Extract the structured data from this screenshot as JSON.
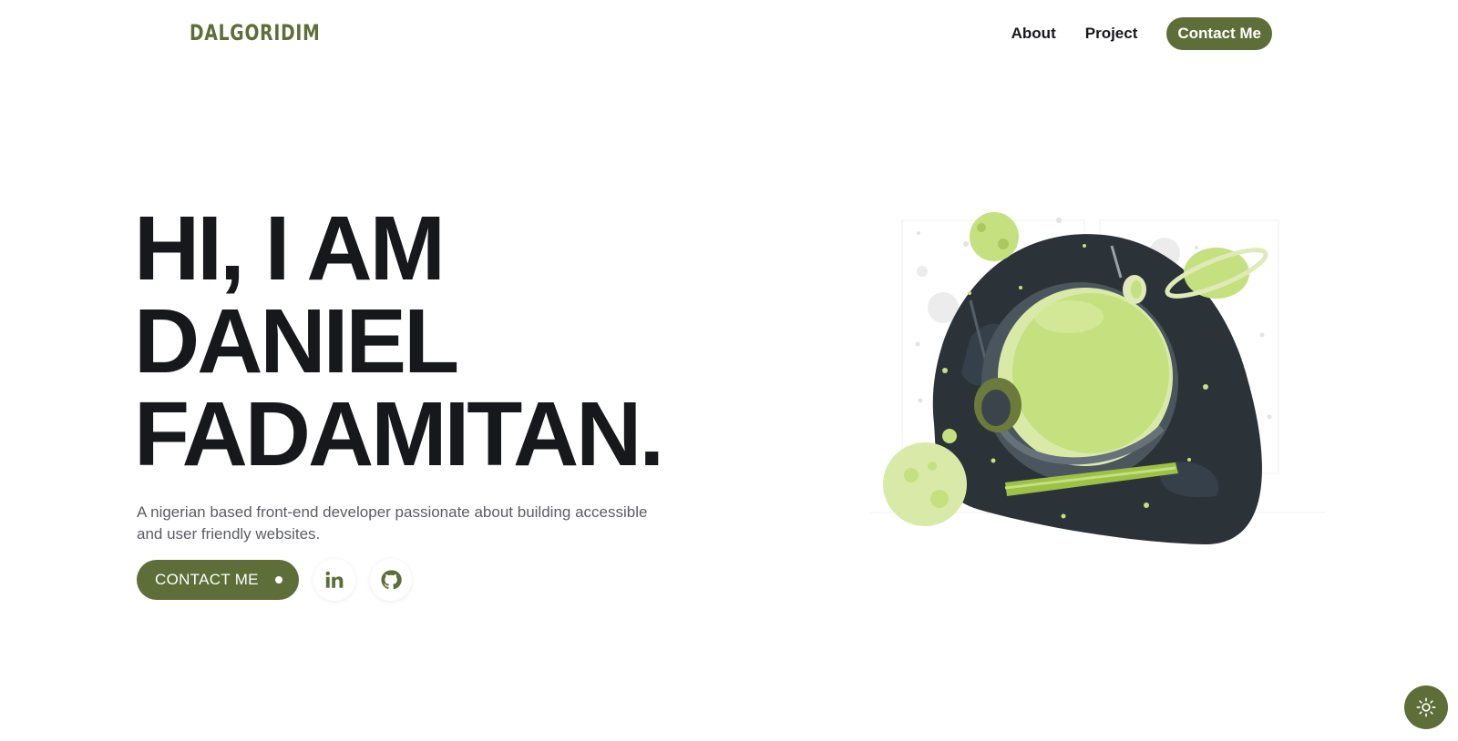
{
  "header": {
    "logo": "DALGORIDIM",
    "nav": [
      {
        "label": "About"
      },
      {
        "label": "Project"
      }
    ],
    "cta_label": "Contact Me"
  },
  "hero": {
    "title_lines": [
      "HI, I AM",
      "DANIEL",
      "FADAMITAN."
    ],
    "subtitle": "A nigerian based front-end developer passionate about building accessible and user friendly websites.",
    "cta_label": "CONTACT ME",
    "social": [
      {
        "icon": "linkedin-icon"
      },
      {
        "icon": "github-icon"
      }
    ]
  },
  "illustration": {
    "subject": "astronaut-helmet-space-illustration"
  },
  "theme_toggle": {
    "icon": "sun-icon"
  },
  "colors": {
    "accent": "#5e6e38",
    "text": "#17181c",
    "muted": "#5b5d63",
    "lime": "#c5e07f",
    "space": "#2b3338"
  }
}
